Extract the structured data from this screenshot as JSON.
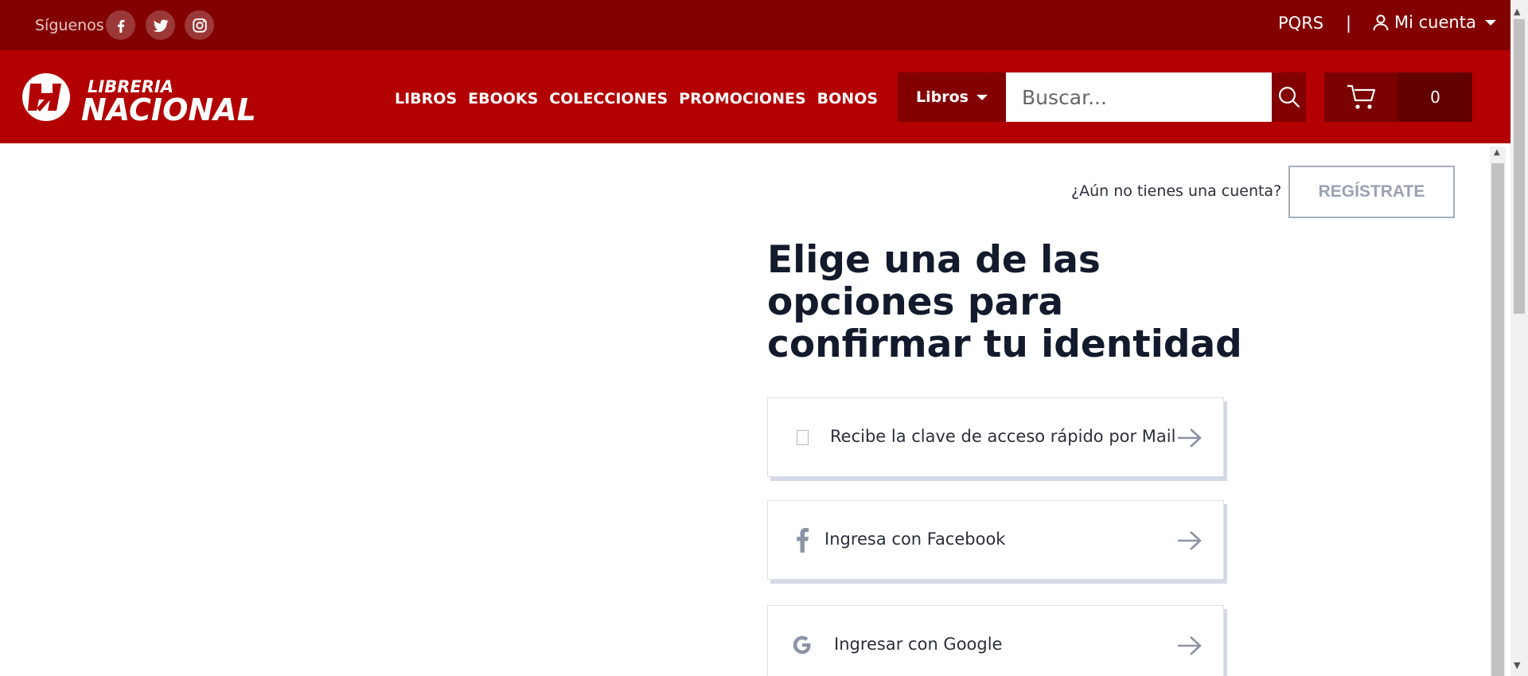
{
  "topbar": {
    "follow_label": "Síguenos",
    "social": [
      "facebook-icon",
      "twitter-icon",
      "instagram-icon"
    ],
    "pqrs_label": "PQRS",
    "separator": "|",
    "account_label": "Mi cuenta"
  },
  "header": {
    "logo": {
      "line1": "LIBRERIA",
      "line2": "NACIONAL"
    },
    "nav": [
      "LIBROS",
      "EBOOKS",
      "COLECCIONES",
      "PROMOCIONES",
      "BONOS"
    ],
    "category_selected": "Libros",
    "search_placeholder": "Buscar...",
    "cart_count": "0"
  },
  "main": {
    "signup_prompt": "¿Aún no tienes una cuenta?",
    "signup_button": "REGÍSTRATE",
    "heading": "Elige una de las opciones para confirmar tu identidad",
    "options": [
      {
        "label": "Recibe la clave de acceso rápido por Mail",
        "icon": "mail-icon"
      },
      {
        "label": "Ingresa con Facebook",
        "icon": "facebook-icon"
      },
      {
        "label": "Ingresar con Google",
        "icon": "google-icon"
      }
    ]
  },
  "colors": {
    "topbar": "#820000",
    "header": "#b30000",
    "heading_text": "#131a2c",
    "muted": "#9aa1b3"
  }
}
